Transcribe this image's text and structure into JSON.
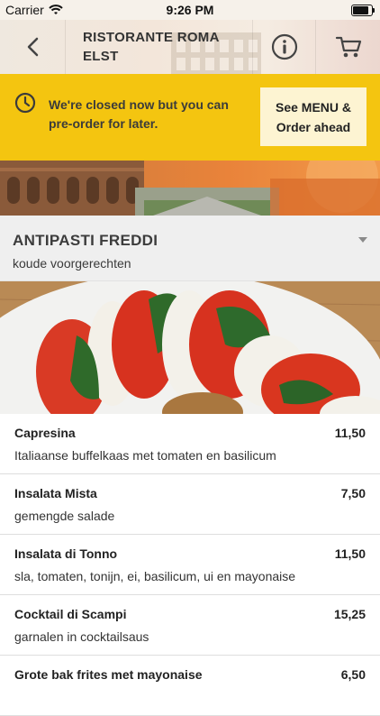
{
  "status_bar": {
    "carrier": "Carrier",
    "time": "9:26 PM",
    "battery_level": 0.95
  },
  "header": {
    "title_line1": "RISTORANTE ROMA",
    "title_line2": "ELST"
  },
  "closed_banner": {
    "message": "We're closed now but you can pre-order for later.",
    "button_line1": "See MENU &",
    "button_line2": "Order ahead"
  },
  "category": {
    "name": "ANTIPASTI FREDDI",
    "subtitle": "koude voorgerechten"
  },
  "items": [
    {
      "name": "Capresina",
      "description": "Italiaanse buffelkaas met tomaten en basilicum",
      "price": "11,50"
    },
    {
      "name": "Insalata Mista",
      "description": "gemengde salade",
      "price": "7,50"
    },
    {
      "name": "Insalata di Tonno",
      "description": "sla, tomaten, tonijn, ei, basilicum, ui en mayonaise",
      "price": "11,50"
    },
    {
      "name": "Cocktail di Scampi",
      "description": "garnalen in cocktailsaus",
      "price": "15,25"
    },
    {
      "name": "Grote bak frites met mayonaise",
      "description": "",
      "price": "6,50"
    }
  ],
  "icons": {
    "wifi": "wifi-icon",
    "battery": "battery-icon",
    "back": "chevron-left-icon",
    "info": "info-icon",
    "cart": "cart-icon",
    "clock": "clock-icon",
    "caret": "caret-down-icon"
  },
  "colors": {
    "banner": "#f4c510",
    "banner_button": "#fdf4d2",
    "category_bg": "#efefef"
  }
}
